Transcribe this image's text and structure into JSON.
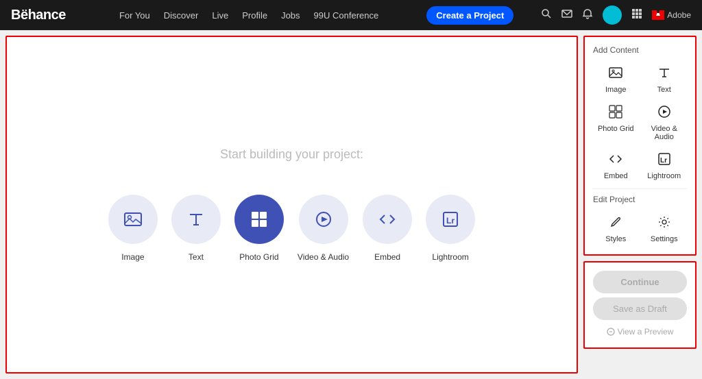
{
  "navbar": {
    "brand": "Bëhance",
    "links": [
      "For You",
      "Discover",
      "Live",
      "Profile",
      "Jobs",
      "99U Conference"
    ],
    "cta_label": "Create a Project",
    "icons": [
      "search-icon",
      "mail-icon",
      "bell-icon",
      "grid-icon"
    ],
    "adobe_label": "Adobe"
  },
  "canvas": {
    "prompt": "Start building your project:",
    "tools": [
      {
        "id": "image",
        "label": "Image"
      },
      {
        "id": "text",
        "label": "Text"
      },
      {
        "id": "photo-grid",
        "label": "Photo Grid"
      },
      {
        "id": "video-audio",
        "label": "Video & Audio"
      },
      {
        "id": "embed",
        "label": "Embed"
      },
      {
        "id": "lightroom",
        "label": "Lightroom"
      }
    ]
  },
  "sidebar": {
    "add_content_title": "Add Content",
    "add_items": [
      {
        "id": "image",
        "label": "Image"
      },
      {
        "id": "text",
        "label": "Text"
      },
      {
        "id": "photo-grid",
        "label": "Photo Grid"
      },
      {
        "id": "video-audio",
        "label": "Video & Audio"
      },
      {
        "id": "embed",
        "label": "Embed"
      },
      {
        "id": "lightroom",
        "label": "Lightroom"
      }
    ],
    "edit_project_title": "Edit Project",
    "edit_items": [
      {
        "id": "styles",
        "label": "Styles"
      },
      {
        "id": "settings",
        "label": "Settings"
      }
    ]
  },
  "actions": {
    "continue_label": "Continue",
    "draft_label": "Save as Draft",
    "preview_label": "View a Preview"
  }
}
